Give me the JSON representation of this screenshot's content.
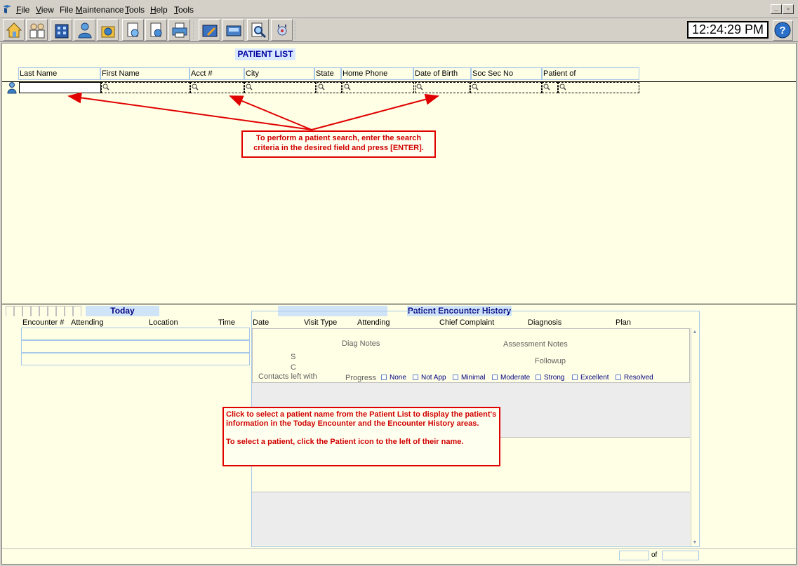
{
  "menubar": {
    "items": [
      "File",
      "View",
      "File Maintenance",
      "Tools",
      "Help",
      "Tools"
    ],
    "underline": [
      "F",
      "V",
      "M",
      "T",
      "H",
      "T"
    ]
  },
  "window_controls": {
    "minimize": "_",
    "restore": "▫"
  },
  "toolbar": {
    "buttons": [
      "home-icon",
      "people-icon",
      "building-icon",
      "user-icon",
      "help-desk-icon",
      "document-search-icon",
      "document-view-icon",
      "printer-icon",
      "tools-icon",
      "inbox-icon",
      "magnify-icon",
      "stethoscope-icon"
    ],
    "clock": "12:24:29 PM",
    "help": "?"
  },
  "patient_list": {
    "title": "PATIENT LIST",
    "columns": [
      "Last Name",
      "First Name",
      "Acct #",
      "City",
      "State",
      "Home Phone",
      "Date of Birth",
      "Soc Sec No",
      "Patient of"
    ]
  },
  "callouts": {
    "search": "To perform a patient search, enter the search criteria in the desired field and press [ENTER].",
    "select_line1": "Click to select a patient name from the Patient List to display the patient's information in the Today Encounter and the Encounter History areas.",
    "select_line2": "To select a patient, click the Patient icon to the left of their name."
  },
  "today": {
    "title": "Today",
    "columns": [
      "Encounter #",
      "Attending",
      "Location",
      "Time"
    ]
  },
  "encounter_history": {
    "title": "Patient Encounter History",
    "columns": [
      "Date",
      "Visit Type",
      "Attending",
      "Chief Complaint",
      "Diagnosis",
      "Plan"
    ],
    "diag_notes": "Diag Notes",
    "assessment_notes": "Assessment Notes",
    "s_label": "S",
    "c_label": "C",
    "followup": "Followup",
    "contacts": "Contacts left with",
    "progress_label": "Progress",
    "progress_options": [
      "None",
      "Not App",
      "Minimal",
      "Moderate",
      "Strong",
      "Excellent",
      "Resolved"
    ]
  },
  "pager": {
    "of": "of"
  },
  "colors": {
    "background": "#ffffe6",
    "accent_blue": "#000080",
    "callout_red": "#d00000"
  }
}
